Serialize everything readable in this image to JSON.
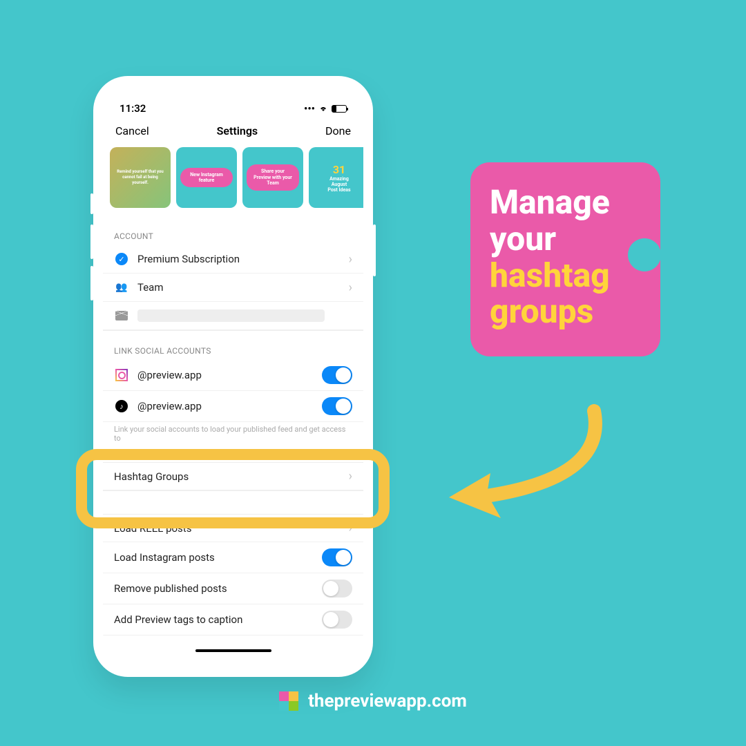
{
  "status": {
    "time": "11:32"
  },
  "nav": {
    "cancel": "Cancel",
    "title": "Settings",
    "done": "Done"
  },
  "thumbs": [
    "Remind yourself that you cannot fail at being yourself.",
    "New Instagram feature",
    "Share your Preview with your Team",
    "31 Amazing August Post Ideas"
  ],
  "sections": {
    "account": {
      "header": "ACCOUNT",
      "premium": "Premium Subscription",
      "team": "Team"
    },
    "social": {
      "header": "LINK SOCIAL ACCOUNTS",
      "ig": "@preview.app",
      "tt": "@preview.app",
      "help": "Link your social accounts to load your published feed and get access to"
    },
    "hashtag": "Hashtag Groups",
    "settings": {
      "reel": "Load REEL posts",
      "insta": "Load Instagram posts",
      "remove": "Remove published posts",
      "tags": "Add Preview tags to caption"
    }
  },
  "callout": {
    "l1": "Manage",
    "l2": "your",
    "l3": "hashtag",
    "l4": "groups"
  },
  "footer": "thepreviewapp.com"
}
